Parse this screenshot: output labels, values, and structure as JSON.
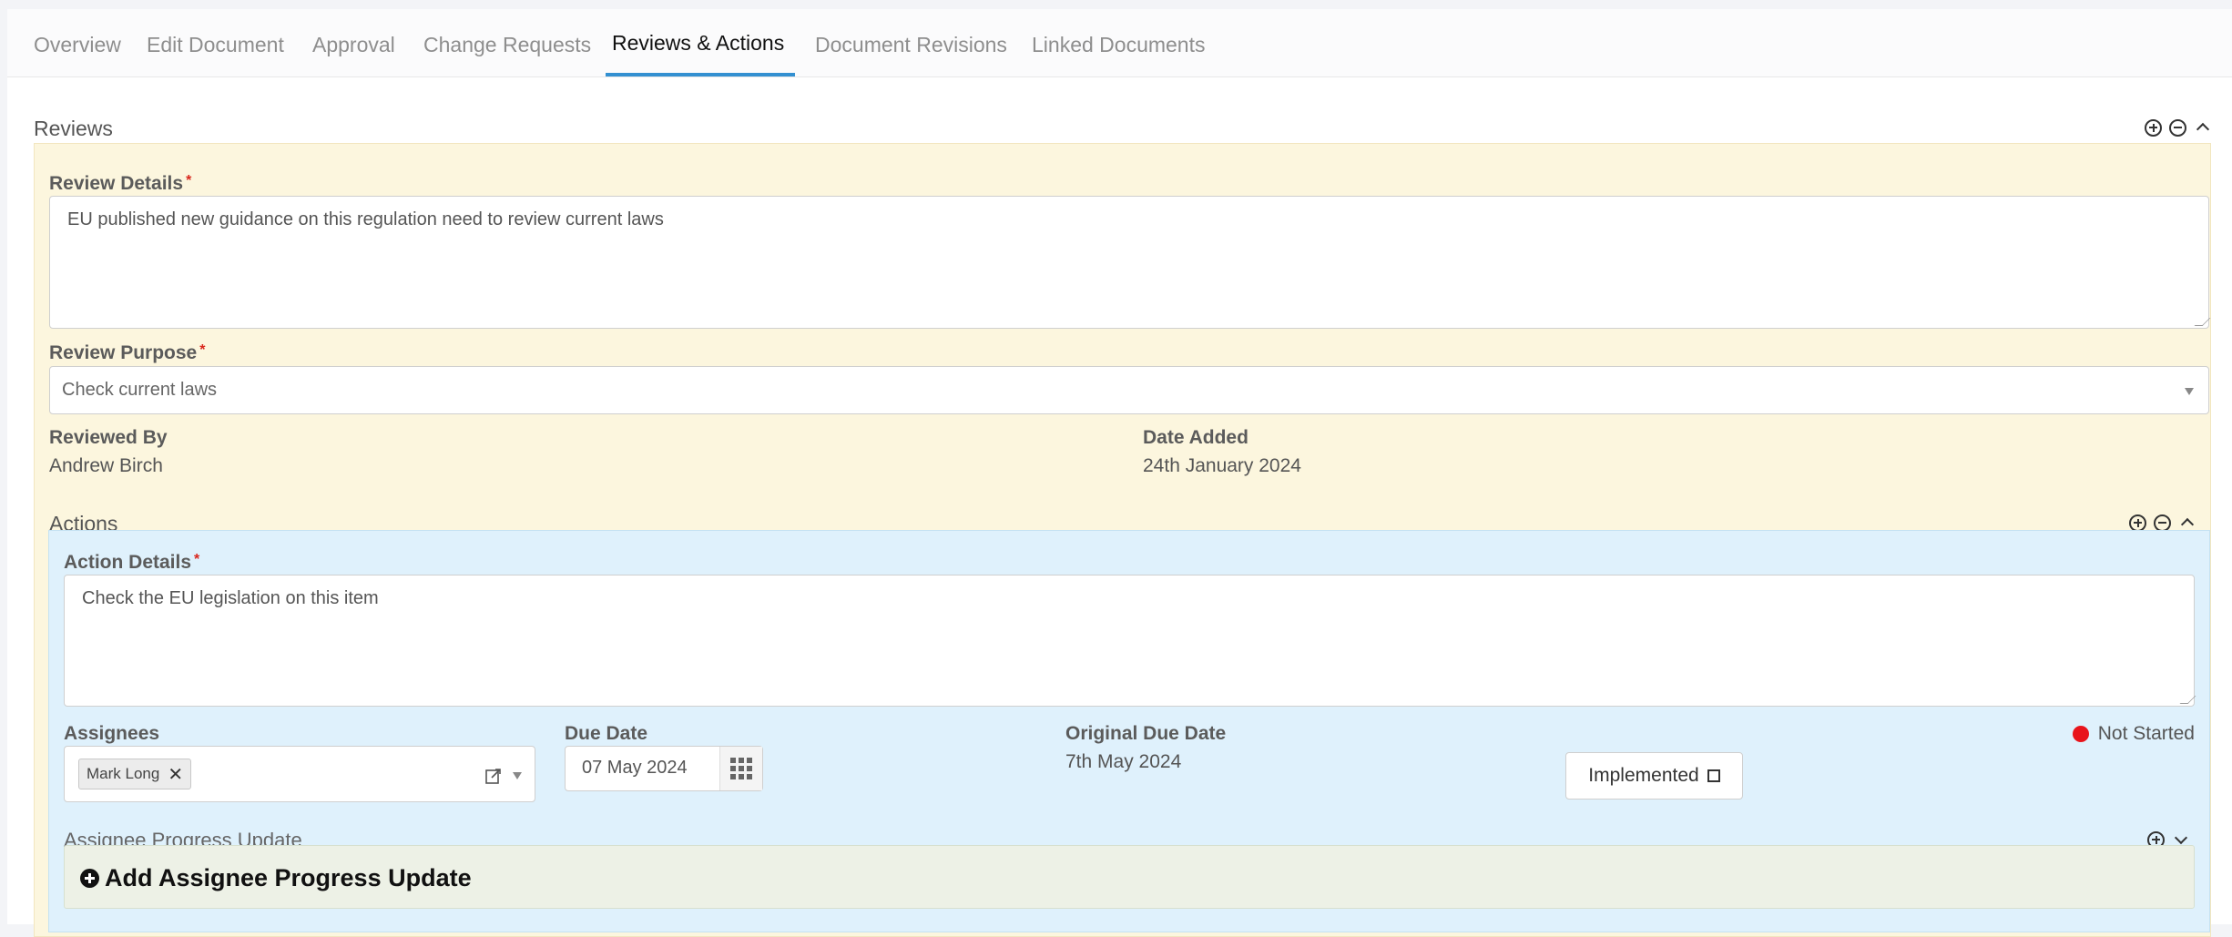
{
  "tabs": [
    {
      "label": "Overview",
      "active": false
    },
    {
      "label": "Edit Document",
      "active": false
    },
    {
      "label": "Approval",
      "active": false
    },
    {
      "label": "Change Requests",
      "active": false
    },
    {
      "label": "Reviews & Actions",
      "active": true
    },
    {
      "label": "Document Revisions",
      "active": false
    },
    {
      "label": "Linked Documents",
      "active": false
    }
  ],
  "reviews": {
    "title": "Reviews",
    "review_details": {
      "label": "Review Details",
      "required": "*",
      "value": "EU published new guidance on this regulation need to review current laws"
    },
    "review_purpose": {
      "label": "Review Purpose",
      "required": "*",
      "value": "Check current laws"
    },
    "reviewed_by": {
      "label": "Reviewed By",
      "value": "Andrew Birch"
    },
    "date_added": {
      "label": "Date Added",
      "value": "24th January 2024"
    }
  },
  "actions": {
    "title": "Actions",
    "action_details": {
      "label": "Action Details",
      "required": "*",
      "value": "Check the EU legislation on this item"
    },
    "assignees": {
      "label": "Assignees",
      "chips": [
        "Mark Long"
      ],
      "remove_glyph": "✕"
    },
    "due_date": {
      "label": "Due Date",
      "value": "07 May 2024"
    },
    "original_due_date": {
      "label": "Original Due Date",
      "value": "7th May 2024"
    },
    "implemented": {
      "label": "Implemented",
      "checked": false
    },
    "status": {
      "label": "Not Started",
      "color": "#e8141b"
    },
    "progress": {
      "title": "Assignee Progress Update",
      "add_label": "Add Assignee Progress Update"
    }
  },
  "colors": {
    "accent": "#3390d1",
    "review_bg": "#fcf6de",
    "action_bg": "#dff1fc",
    "progress_bg": "#edf1e6"
  }
}
